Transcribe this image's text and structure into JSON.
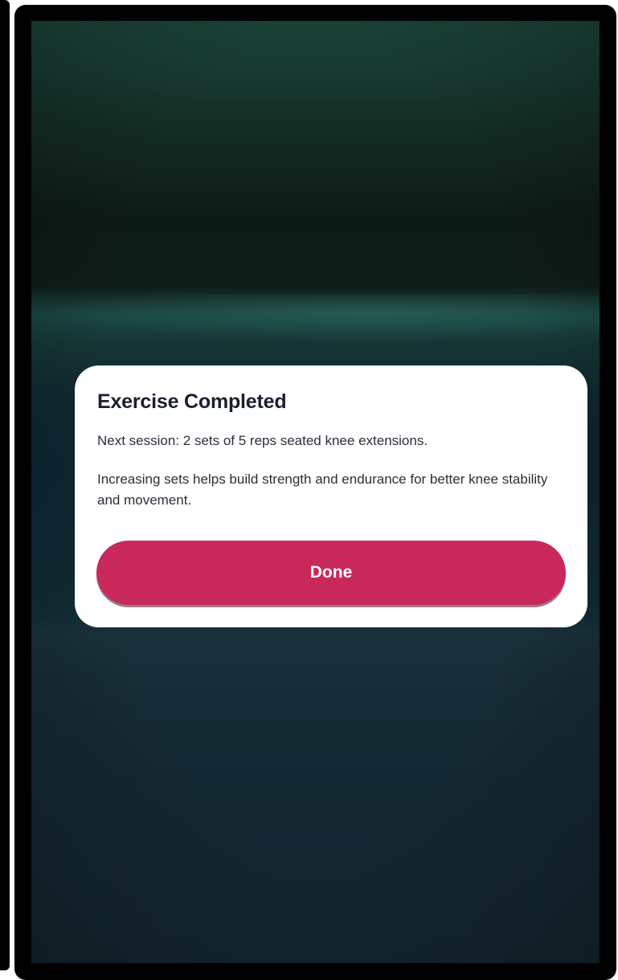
{
  "dialog": {
    "title": "Exercise Completed",
    "next_session": "Next session: 2 sets of 5 reps seated knee extensions.",
    "reason": "Increasing sets helps build strength and endurance for better knee stability and movement.",
    "done_label": "Done"
  },
  "colors": {
    "accent": "#c8285a",
    "card": "#ffffff",
    "title_text": "#1a1f2e",
    "background_top": "#1a4238",
    "background_bottom": "#13252f"
  }
}
